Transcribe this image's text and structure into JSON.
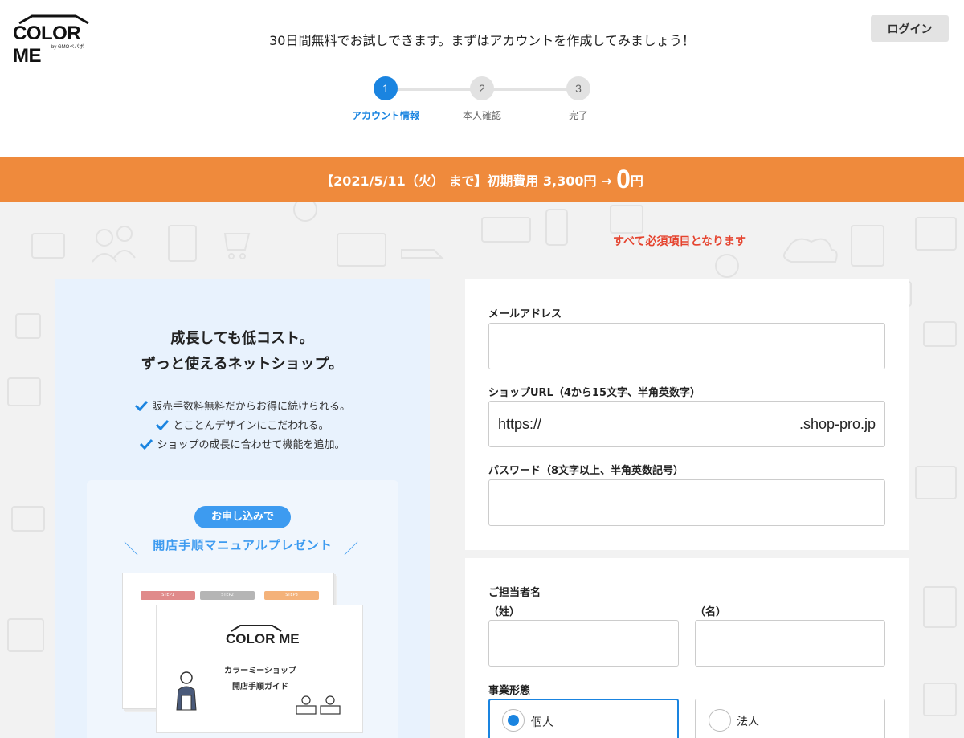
{
  "header": {
    "logo_text": "COLOR ME",
    "logo_sub": "by GMOペパボ",
    "message": "30日間無料でお試しできます。まずはアカウントを作成してみましょう！",
    "login_label": "ログイン"
  },
  "steps": [
    {
      "number": "1",
      "label": "アカウント情報",
      "active": true
    },
    {
      "number": "2",
      "label": "本人確認",
      "active": false
    },
    {
      "number": "3",
      "label": "完了",
      "active": false
    }
  ],
  "banner": {
    "prefix": "【2021/5/11（火） まで】初期費用 ",
    "old_price": "3,300円",
    "arrow": " → ",
    "new_price": "0",
    "unit": "円"
  },
  "required_note": "すべて必須項目となります",
  "promo": {
    "title_line1": "成長しても低コスト。",
    "title_line2": "ずっと使えるネットショップ。",
    "benefits": [
      "販売手数料無料だからお得に続けられる。",
      "とことんデザインにこだわれる。",
      "ショップの成長に合わせて機能を追加。"
    ],
    "pill": "お申し込みで",
    "manual_title": "開店手順マニュアルプレゼント",
    "doc_tabs": [
      "STEP1",
      "STEP2",
      "STEP3"
    ],
    "doc_logo": "COLOR ME",
    "doc_line1": "カラーミーショップ",
    "doc_line2": "開店手順ガイド"
  },
  "form": {
    "email_label": "メールアドレス",
    "email_value": "",
    "url_label": "ショップURL（4から15文字、半角英数字）",
    "url_prefix": "https://",
    "url_value": "",
    "url_suffix": ".shop-pro.jp",
    "password_label": "パスワード（8文字以上、半角英数記号）",
    "password_value": "",
    "contact_label": "ご担当者名",
    "last_name_label": "（姓）",
    "first_name_label": "（名）",
    "last_name_value": "",
    "first_name_value": "",
    "business_label": "事業形態",
    "business_options": [
      "個人",
      "法人"
    ],
    "business_selected": "個人"
  },
  "colors": {
    "accent": "#1a84e0",
    "banner": "#ef8a3c",
    "required": "#e5432e",
    "promo_bg": "#e8f2fd"
  }
}
